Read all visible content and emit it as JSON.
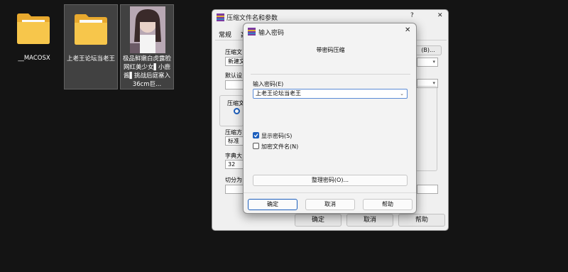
{
  "desktop": {
    "items": [
      {
        "label": "__MACOSX"
      },
      {
        "label": "上老王论坛当老王"
      },
      {
        "label": "极品鲜嫩白虎露脸网红美少女▌小鹿酱▌挑战后庭塞入36cm巨..."
      }
    ]
  },
  "bg_dialog": {
    "title": "压缩文件名和参数",
    "help_glyph": "?",
    "close_glyph": "✕",
    "tab_general": "常规",
    "tab_advanced": "高",
    "archive_name_label": "压缩文",
    "archive_name_value": "新建文",
    "browse_button": "(B)...",
    "default_profile_label": "默认设",
    "archive_format_label": "压缩文",
    "method_label": "压缩方",
    "method_value": "标准",
    "dict_size_label": "字典大",
    "dict_size_value": "32",
    "split_label": "切分为",
    "ok_button": "确定",
    "cancel_button": "取消",
    "help_button": "帮助"
  },
  "dialog": {
    "title": "输入密码",
    "close_glyph": "✕",
    "header": "带密码压缩",
    "password_label": "输入密码(E)",
    "password_value": "上老王论坛当老王",
    "show_password_label": "显示密码(S)",
    "show_password_checked": true,
    "encrypt_names_label": "加密文件名(N)",
    "encrypt_names_checked": false,
    "organize_button": "整理密码(O)...",
    "ok_button": "确定",
    "cancel_button": "取消",
    "help_button": "帮助",
    "accent_color": "#1d5fbd"
  }
}
